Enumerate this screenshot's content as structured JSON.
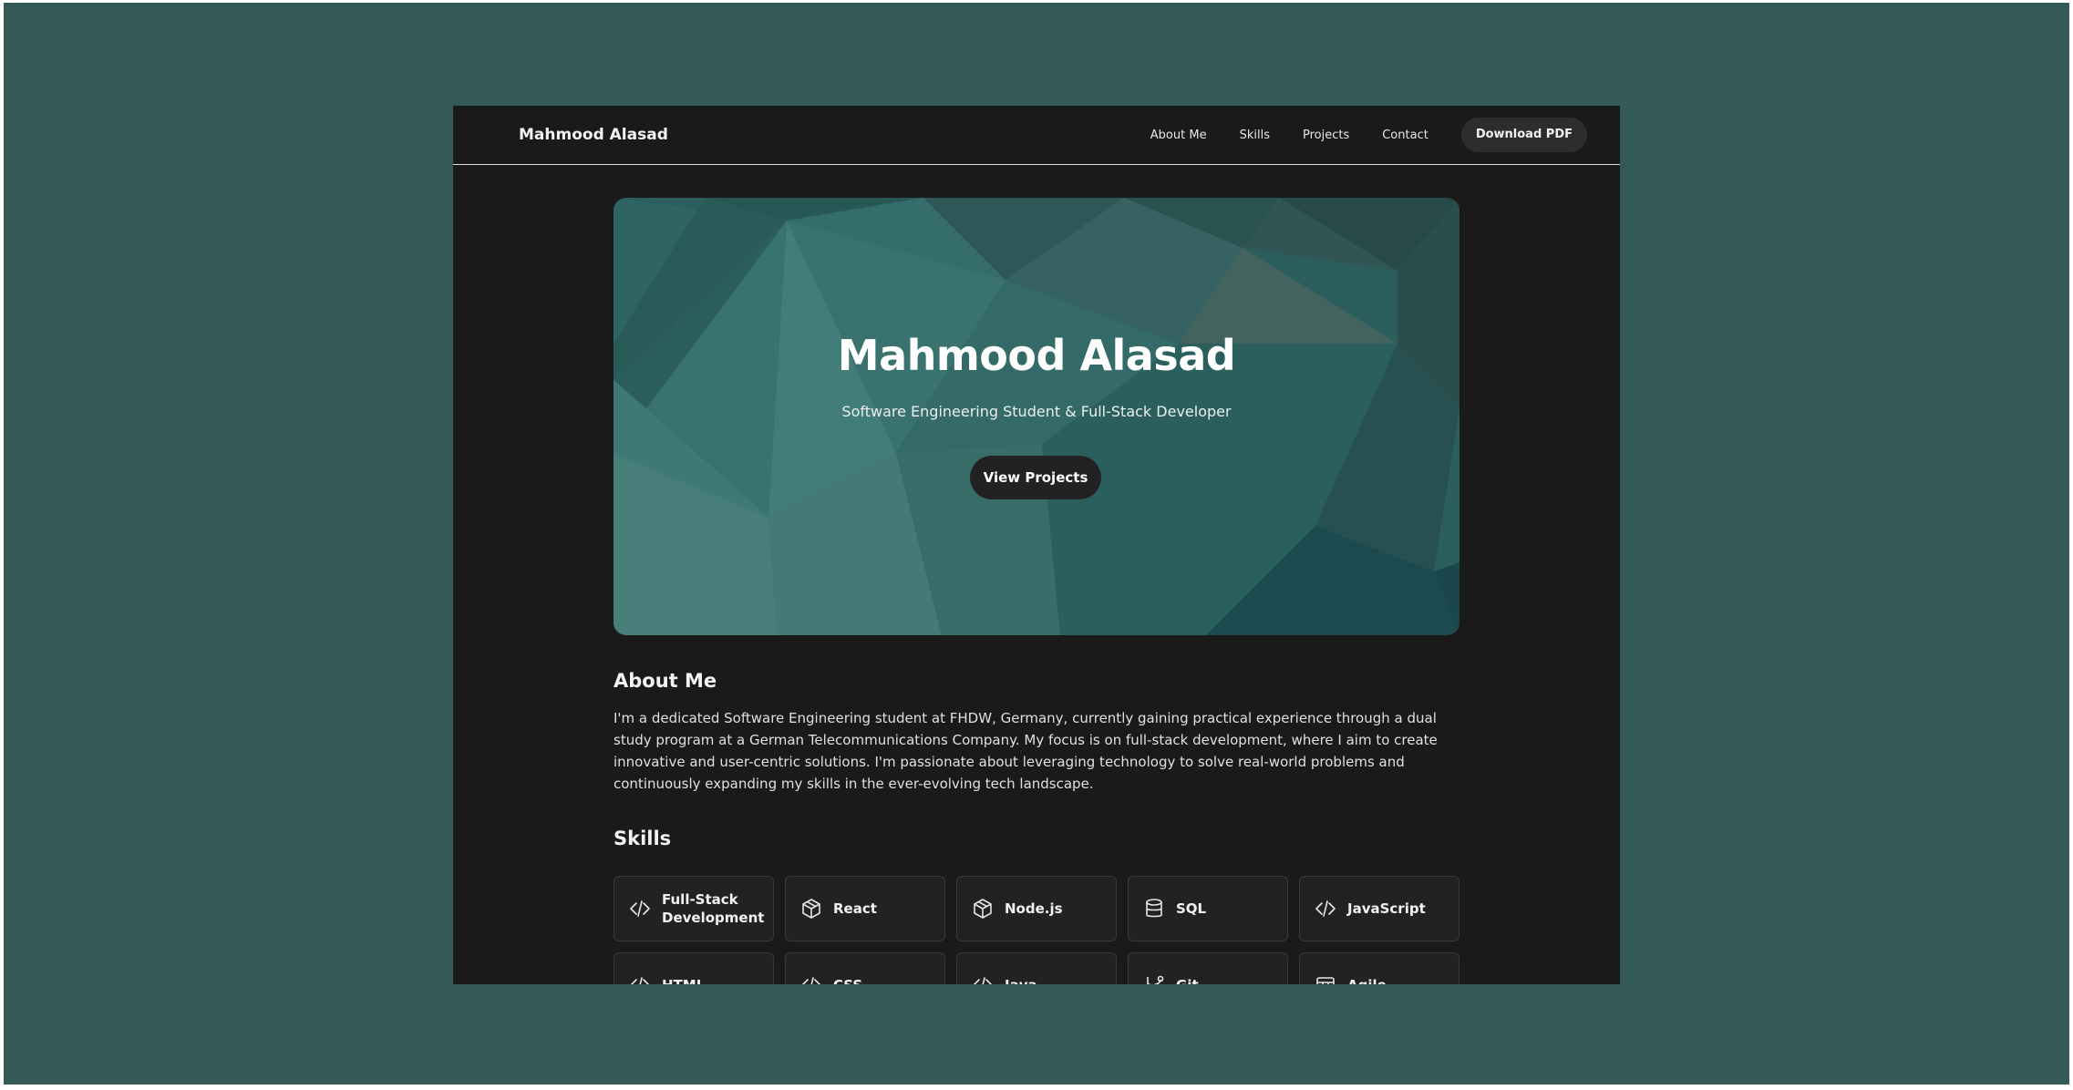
{
  "navbar": {
    "brand": "Mahmood Alasad",
    "links": [
      "About Me",
      "Skills",
      "Projects",
      "Contact"
    ],
    "download_label": "Download PDF"
  },
  "hero": {
    "title": "Mahmood Alasad",
    "subtitle": "Software Engineering Student & Full-Stack Developer",
    "button_label": "View Projects"
  },
  "about": {
    "title": "About Me",
    "text": "I'm a dedicated Software Engineering student at FHDW, Germany, currently gaining practical experience through a dual study program at a German Telecommunications Company. My focus is on full-stack development, where I aim to create innovative and user-centric solutions. I'm passionate about leveraging technology to solve real-world problems and continuously expanding my skills in the ever-evolving tech landscape."
  },
  "skills": {
    "title": "Skills",
    "items": [
      {
        "label": "Full-Stack Development",
        "icon": "code-icon"
      },
      {
        "label": "React",
        "icon": "package-icon"
      },
      {
        "label": "Node.js",
        "icon": "package-icon"
      },
      {
        "label": "SQL",
        "icon": "database-icon"
      },
      {
        "label": "JavaScript",
        "icon": "code-icon"
      },
      {
        "label": "HTML",
        "icon": "code-icon"
      },
      {
        "label": "CSS",
        "icon": "code-icon"
      },
      {
        "label": "Java",
        "icon": "code-icon"
      },
      {
        "label": "Git",
        "icon": "git-icon"
      },
      {
        "label": "Agile",
        "icon": "board-icon"
      }
    ]
  },
  "colors": {
    "backdrop": "#335a57",
    "page_bg": "#1a1a1a",
    "hero_accent": "#3f7e7b"
  }
}
